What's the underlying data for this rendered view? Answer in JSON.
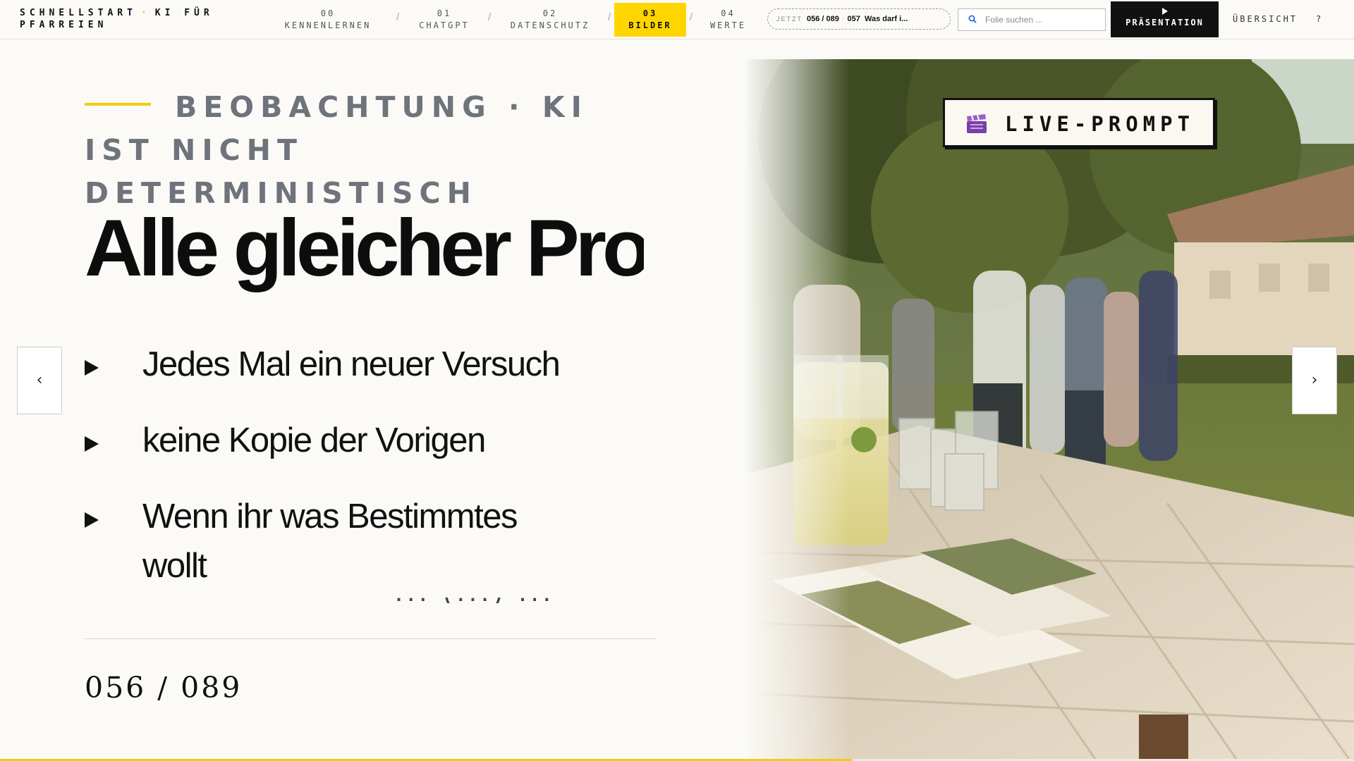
{
  "brand": {
    "title": "SCHNELLSTART",
    "dot": "·",
    "subtitle": "KI FÜR PFARREIEN"
  },
  "nav": [
    {
      "num": "00",
      "label": "KENNENLERNEN",
      "active": false
    },
    {
      "num": "01",
      "label": "CHATGPT",
      "active": false
    },
    {
      "num": "02",
      "label": "DATENSCHUTZ",
      "active": false
    },
    {
      "num": "03",
      "label": "BILDER",
      "active": true
    },
    {
      "num": "04",
      "label": "WERTE",
      "active": false
    }
  ],
  "nav_separator": "/",
  "jetzt": {
    "label": "JETZT",
    "current": "056 / 089",
    "next": "057",
    "next_title": "Was darf i..."
  },
  "search": {
    "placeholder": "Folie suchen ..."
  },
  "present_button": {
    "icon": "play-icon",
    "label": "PRÄSENTATION"
  },
  "overview_label": "ÜBERSICHT",
  "help_label": "?",
  "slide": {
    "eyebrow": "BEOBACHTUNG · KI IST NICHT DETERMINISTISCH",
    "title": "Alle gleicher Prompt",
    "bullets": [
      "Jedes Mal ein neuer Versuch",
      "keine Kopie der Vorigen",
      "Wenn ihr was Bestimmtes wollt"
    ],
    "overflow_text": "... (...) ...",
    "counter": "056 / 089",
    "badge": {
      "icon": "clapperboard-icon",
      "label": "LIVE-PROMPT"
    }
  },
  "progress": {
    "current": 56,
    "total": 89,
    "fraction": 0.629
  },
  "arrows": {
    "prev": "‹",
    "next": "›"
  },
  "colors": {
    "accent": "#ffd500",
    "eyebrow": "#6e737c",
    "dark": "#111111",
    "background": "#fbfaf7"
  }
}
